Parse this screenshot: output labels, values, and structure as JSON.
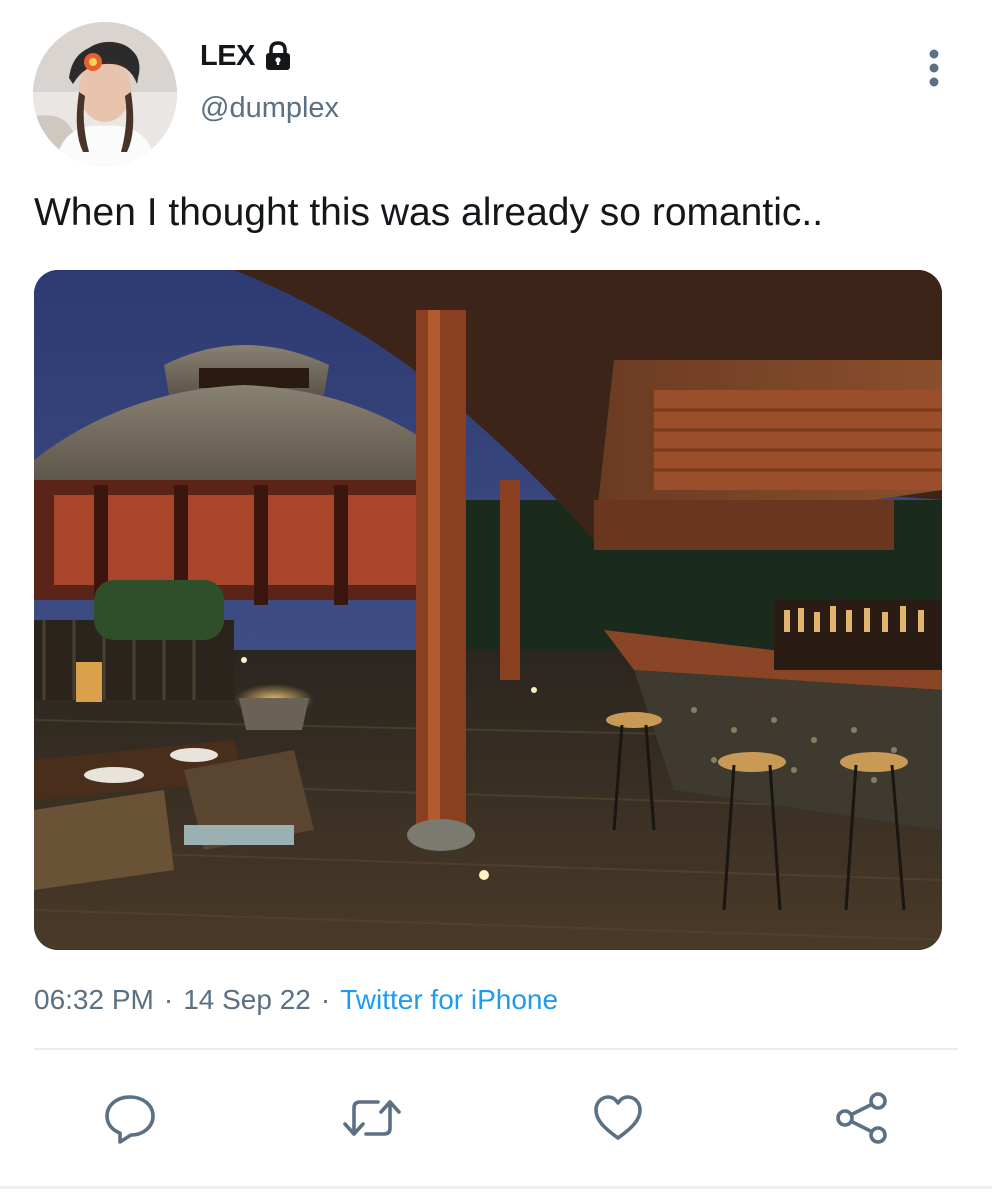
{
  "tweet": {
    "author": {
      "display_name": "LEX",
      "handle": "@dumplex",
      "protected_icon": "lock-icon",
      "avatar": "profile-photo"
    },
    "more_icon": "more-vertical-icon",
    "text": "When I thought this was already so romantic..",
    "media": {
      "description": "night-time resort restaurant with thatched pavilion, wooden deck and lit bar"
    },
    "meta": {
      "time": "06:32 PM",
      "separator": "·",
      "date": "14 Sep 22",
      "source": "Twitter for iPhone"
    },
    "actions": [
      {
        "icon": "reply-icon"
      },
      {
        "icon": "retweet-icon"
      },
      {
        "icon": "like-icon"
      },
      {
        "icon": "share-icon"
      }
    ]
  },
  "colors": {
    "text": "#14171a",
    "secondary": "#5b7083",
    "link": "#1d9bf0",
    "divider": "#e6ecf0"
  }
}
